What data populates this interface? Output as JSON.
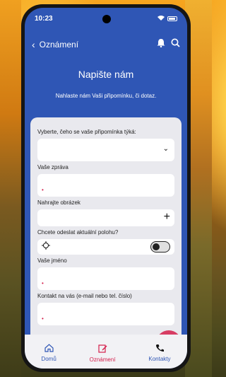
{
  "status_bar": {
    "time": "10:23"
  },
  "app_bar": {
    "title": "Oznámení",
    "back_icon": "chevron-left-icon",
    "bell_icon": "bell-icon",
    "search_icon": "search-icon"
  },
  "hero": {
    "title": "Napište nám",
    "subtitle": "Nahlaste nám Vaši připomínku, či dotaz."
  },
  "form": {
    "category_label": "Vyberte, čeho se vaše připomínka týká:",
    "category_value": "",
    "message_label": "Vaše zpráva",
    "message_value": "",
    "upload_label": "Nahrajte obrázek",
    "location_label": "Chcete odeslat aktuální polohu?",
    "location_enabled": false,
    "name_label": "Vaše jméno",
    "name_value": "",
    "contact_label": "Kontakt na vás (e-mail nebo tel. číslo)",
    "contact_value": "",
    "required_marker": "•"
  },
  "bottom_nav": {
    "items": [
      {
        "label": "Domů",
        "icon": "home-icon",
        "active": false
      },
      {
        "label": "Oznámení",
        "icon": "edit-icon",
        "active": true
      },
      {
        "label": "Kontakty",
        "icon": "phone-icon",
        "active": false
      }
    ]
  },
  "colors": {
    "primary": "#2f56b5",
    "accent": "#d41e4a",
    "card": "#e9e9ee"
  }
}
